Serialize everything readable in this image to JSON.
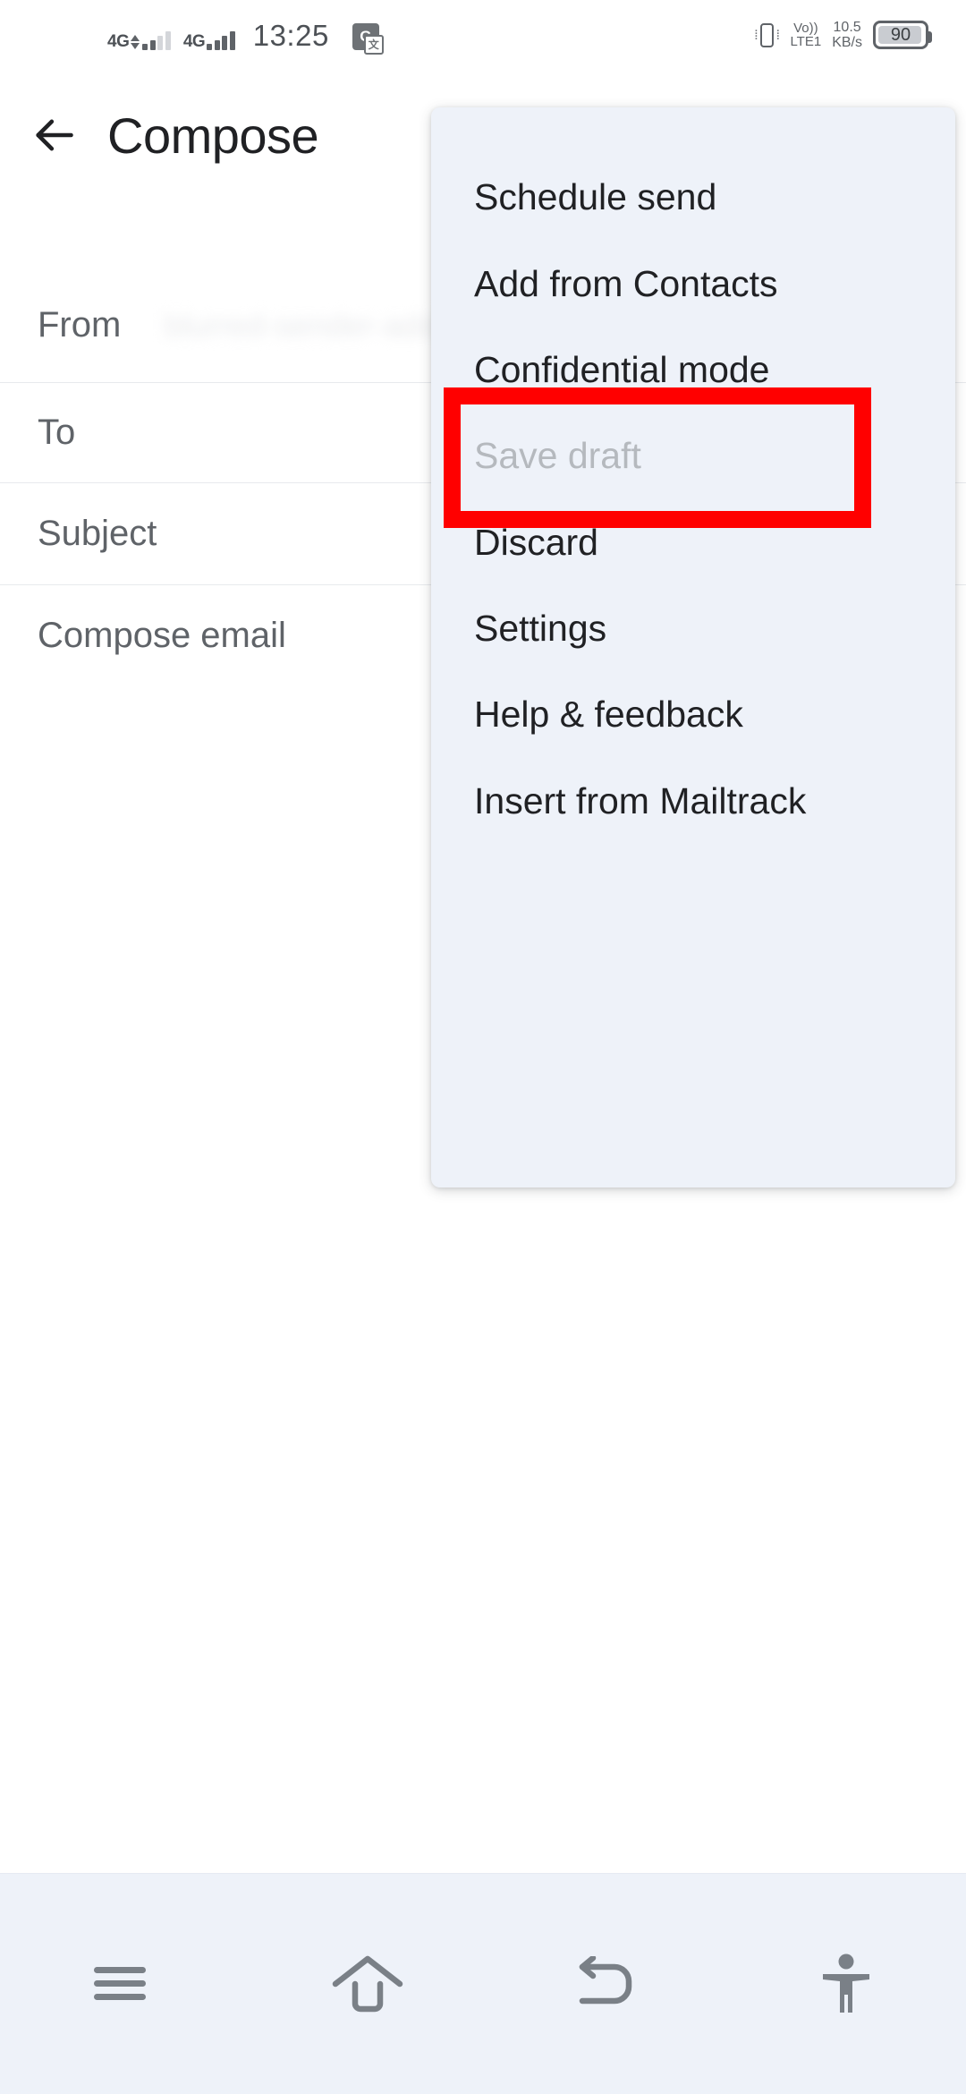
{
  "status_bar": {
    "sim1_network": "4G",
    "sim2_network": "4G",
    "time": "13:25",
    "translate_icon_label": "G",
    "volte_line1": "Vo))",
    "volte_line2": "LTE1",
    "net_speed_value": "10.5",
    "net_speed_unit": "KB/s",
    "battery_level": "90"
  },
  "app_bar": {
    "back_icon": "arrow-left-icon",
    "title": "Compose"
  },
  "compose_fields": [
    {
      "label": "From",
      "value": "blurred-sender-address",
      "blurred": true
    },
    {
      "label": "To",
      "value": "",
      "blurred": false
    },
    {
      "label": "Subject",
      "value": "",
      "blurred": false
    },
    {
      "label": "Compose email",
      "value": "",
      "blurred": false
    }
  ],
  "overflow_menu": {
    "items": [
      {
        "label": "Schedule send",
        "disabled": false
      },
      {
        "label": "Add from Contacts",
        "disabled": false
      },
      {
        "label": "Confidential mode",
        "disabled": false
      },
      {
        "label": "Save draft",
        "disabled": true
      },
      {
        "label": "Discard",
        "disabled": false
      },
      {
        "label": "Settings",
        "disabled": false
      },
      {
        "label": "Help & feedback",
        "disabled": false
      },
      {
        "label": "Insert from Mailtrack",
        "disabled": false
      }
    ],
    "background_color": "#eef2f9"
  },
  "annotation": {
    "target_label": "Confidential mode",
    "color": "#ff0000"
  },
  "nav_bar": {
    "buttons": [
      {
        "icon": "recents-icon"
      },
      {
        "icon": "home-icon"
      },
      {
        "icon": "back-icon"
      },
      {
        "icon": "accessibility-icon"
      }
    ],
    "background_color": "#eef2f9"
  }
}
